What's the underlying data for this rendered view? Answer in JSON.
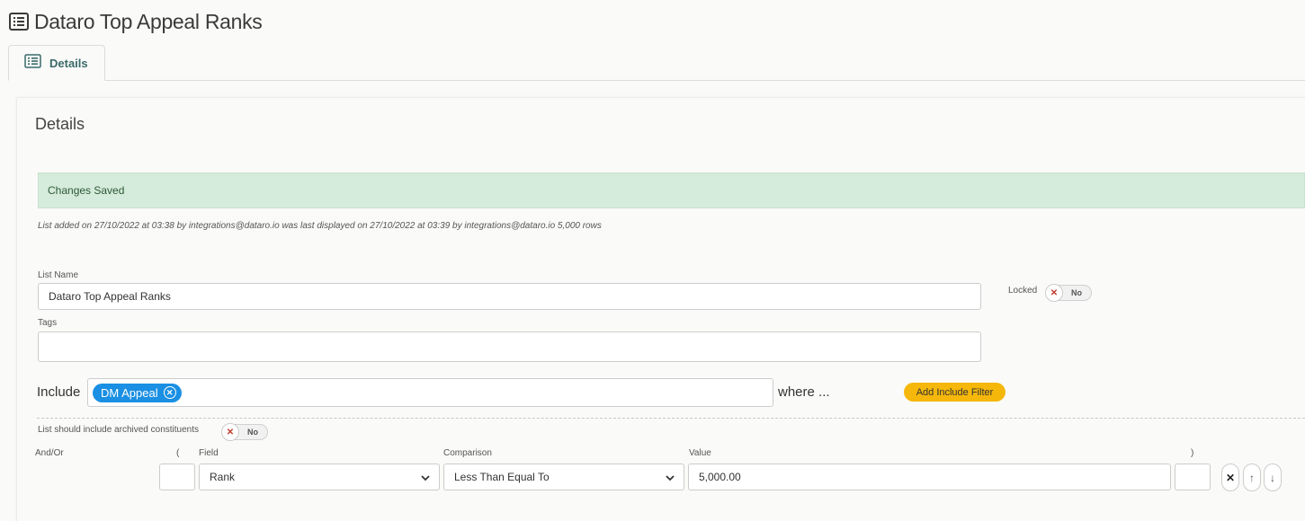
{
  "page": {
    "title": "Dataro Top Appeal Ranks",
    "title_icon": "list-icon"
  },
  "tabs": [
    {
      "label": "Details",
      "icon": "list-icon"
    }
  ],
  "details": {
    "section_title": "Details",
    "alert": "Changes Saved",
    "audit_text": "List added on 27/10/2022 at 03:38 by integrations@dataro.io was last displayed on 27/10/2022 at 03:39 by integrations@dataro.io 5,000 rows",
    "list_name_label": "List Name",
    "list_name_value": "Dataro Top Appeal Ranks",
    "tags_label": "Tags",
    "tags_value": "",
    "locked_label": "Locked",
    "locked_toggle": {
      "state": "No",
      "off_icon": "x-icon"
    }
  },
  "include": {
    "label": "Include",
    "chips": [
      {
        "label": "DM Appeal",
        "remove_icon": "close-circle-icon"
      }
    ],
    "where_text": "where ...",
    "add_filter_label": "Add Include Filter",
    "archived_label": "List should include archived constituents",
    "archived_toggle": {
      "state": "No"
    }
  },
  "filter": {
    "headers": {
      "and_or": "And/Or",
      "open_paren": "(",
      "field": "Field",
      "comparison": "Comparison",
      "value": "Value",
      "close_paren": ")"
    },
    "row": {
      "open_paren": "",
      "field": "Rank",
      "comparison": "Less Than Equal To",
      "value": "5,000.00",
      "close_paren": ""
    }
  },
  "colors": {
    "alert_bg": "#d5ebdb",
    "chip_bg": "#1a8fe3",
    "add_filter_bg": "#f5b70a",
    "tab_text": "#3a6a6a"
  }
}
